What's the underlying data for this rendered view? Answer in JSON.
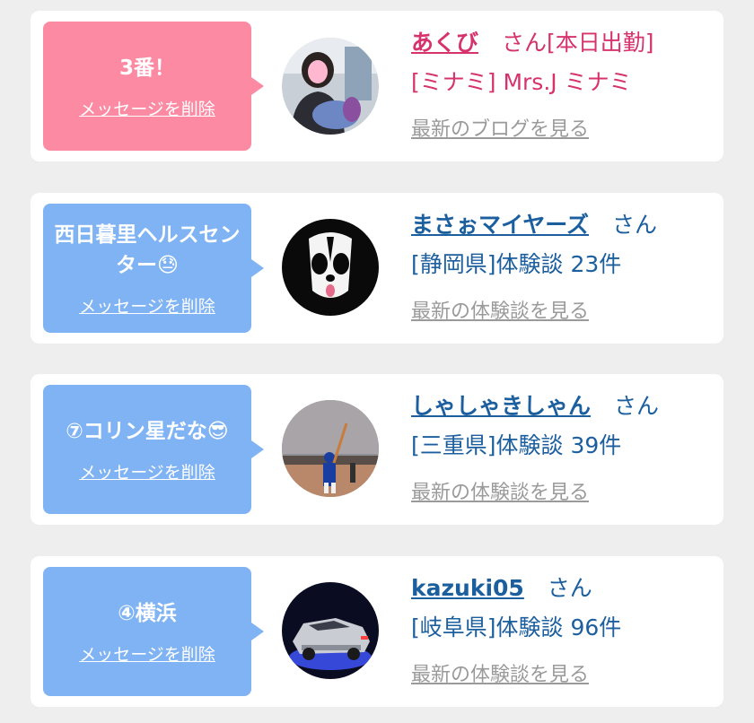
{
  "entries": [
    {
      "message": "3番！",
      "delete_label": "メッセージを削除",
      "username": "あくび",
      "honorific": "さん[本日出勤]",
      "detail": "[ミナミ] Mrs.J ミナミ",
      "link": "最新のブログを見る",
      "avatar_icon": "person-photo-icon",
      "bubble_color": "#fb8aa2"
    },
    {
      "message": "西日暮里ヘルスセンター😓",
      "delete_label": "メッセージを削除",
      "username": "まさぉマイヤーズ",
      "honorific": "さん",
      "detail": "[静岡県]体験談 23件",
      "link": "最新の体験談を見る",
      "avatar_icon": "panda-icon",
      "bubble_color": "#7fb3f4"
    },
    {
      "message": "⑦コリン星だな😎",
      "delete_label": "メッセージを削除",
      "username": "しゃしゃきしゃん",
      "honorific": "さん",
      "detail": "[三重県]体験談 39件",
      "link": "最新の体験談を見る",
      "avatar_icon": "baseball-batter-icon",
      "bubble_color": "#7fb3f4"
    },
    {
      "message": "④横浜",
      "delete_label": "メッセージを削除",
      "username": "kazuki05",
      "honorific": "さん",
      "detail": "[岐阜県]体験談 96件",
      "link": "最新の体験談を見る",
      "avatar_icon": "silver-car-icon",
      "bubble_color": "#7fb3f4"
    }
  ]
}
